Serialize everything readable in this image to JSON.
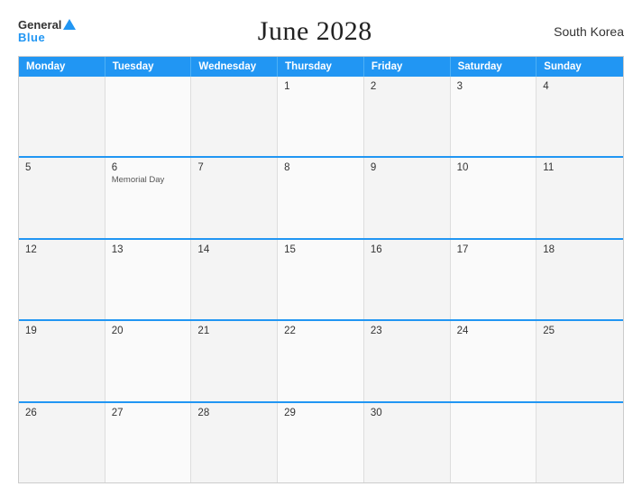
{
  "header": {
    "logo_general": "General",
    "logo_blue": "Blue",
    "title": "June 2028",
    "country": "South Korea"
  },
  "weekdays": [
    "Monday",
    "Tuesday",
    "Wednesday",
    "Thursday",
    "Friday",
    "Saturday",
    "Sunday"
  ],
  "weeks": [
    [
      {
        "date": "",
        "event": ""
      },
      {
        "date": "",
        "event": ""
      },
      {
        "date": "",
        "event": ""
      },
      {
        "date": "1",
        "event": ""
      },
      {
        "date": "2",
        "event": ""
      },
      {
        "date": "3",
        "event": ""
      },
      {
        "date": "4",
        "event": ""
      }
    ],
    [
      {
        "date": "5",
        "event": ""
      },
      {
        "date": "6",
        "event": "Memorial Day"
      },
      {
        "date": "7",
        "event": ""
      },
      {
        "date": "8",
        "event": ""
      },
      {
        "date": "9",
        "event": ""
      },
      {
        "date": "10",
        "event": ""
      },
      {
        "date": "11",
        "event": ""
      }
    ],
    [
      {
        "date": "12",
        "event": ""
      },
      {
        "date": "13",
        "event": ""
      },
      {
        "date": "14",
        "event": ""
      },
      {
        "date": "15",
        "event": ""
      },
      {
        "date": "16",
        "event": ""
      },
      {
        "date": "17",
        "event": ""
      },
      {
        "date": "18",
        "event": ""
      }
    ],
    [
      {
        "date": "19",
        "event": ""
      },
      {
        "date": "20",
        "event": ""
      },
      {
        "date": "21",
        "event": ""
      },
      {
        "date": "22",
        "event": ""
      },
      {
        "date": "23",
        "event": ""
      },
      {
        "date": "24",
        "event": ""
      },
      {
        "date": "25",
        "event": ""
      }
    ],
    [
      {
        "date": "26",
        "event": ""
      },
      {
        "date": "27",
        "event": ""
      },
      {
        "date": "28",
        "event": ""
      },
      {
        "date": "29",
        "event": ""
      },
      {
        "date": "30",
        "event": ""
      },
      {
        "date": "",
        "event": ""
      },
      {
        "date": "",
        "event": ""
      }
    ]
  ]
}
